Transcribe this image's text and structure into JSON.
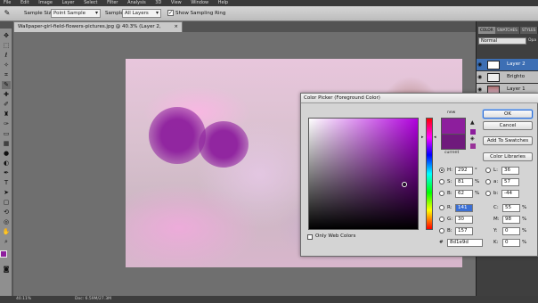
{
  "menubar": {
    "items": [
      "File",
      "Edit",
      "Image",
      "Layer",
      "Select",
      "Filter",
      "Analysis",
      "3D",
      "View",
      "Window",
      "Help"
    ]
  },
  "options": {
    "sample_size_label": "Sample Size:",
    "sample_size_value": "Point Sample",
    "sample_label": "Sample:",
    "sample_value": "All Layers",
    "show_ring_label": "Show Sampling Ring",
    "show_ring_checked": true
  },
  "document": {
    "tab_title": "Wallpaper-girl-field-flowers-pictures.jpg @ 40.3% (Layer 2, RGB/8#) *",
    "close_glyph": "×"
  },
  "status": {
    "zoom": "40.11%",
    "doc": "Doc: 6.59M/27.3M"
  },
  "panel": {
    "tabs": [
      "COLOR",
      "SWATCHES",
      "STYLES"
    ],
    "blend_mode": "Normal",
    "opacity_label": "Opa",
    "layers": [
      {
        "name": "Layer 2",
        "selected": true
      },
      {
        "name": "Brighto",
        "selected": false
      },
      {
        "name": "Layer 1",
        "selected": false
      }
    ]
  },
  "color_picker": {
    "title": "Color Picker (Foreground Color)",
    "new_label": "new",
    "current_label": "current",
    "new_color": "#8d1e9d",
    "current_color": "#6f1a7c",
    "buttons": {
      "ok": "OK",
      "cancel": "Cancel",
      "add_swatches": "Add To Swatches",
      "libraries": "Color Libraries"
    },
    "hsb": {
      "h": {
        "label": "H:",
        "value": "292",
        "unit": "°"
      },
      "s": {
        "label": "S:",
        "value": "81",
        "unit": "%"
      },
      "b": {
        "label": "B:",
        "value": "62",
        "unit": "%"
      }
    },
    "rgb": {
      "r": {
        "label": "R:",
        "value": "141"
      },
      "g": {
        "label": "G:",
        "value": "30"
      },
      "b": {
        "label": "B:",
        "value": "157"
      }
    },
    "lab": {
      "l": {
        "label": "L:",
        "value": "36"
      },
      "a": {
        "label": "a:",
        "value": "57"
      },
      "b": {
        "label": "b:",
        "value": "-44"
      }
    },
    "cmyk": {
      "c": {
        "label": "C:",
        "value": "55",
        "unit": "%"
      },
      "m": {
        "label": "M:",
        "value": "98",
        "unit": "%"
      },
      "y": {
        "label": "Y:",
        "value": "0",
        "unit": "%"
      },
      "k": {
        "label": "K:",
        "value": "0",
        "unit": "%"
      }
    },
    "only_web_colors": "Only Web Colors",
    "hex_prefix": "#",
    "hex_value": "8d1e9d"
  }
}
